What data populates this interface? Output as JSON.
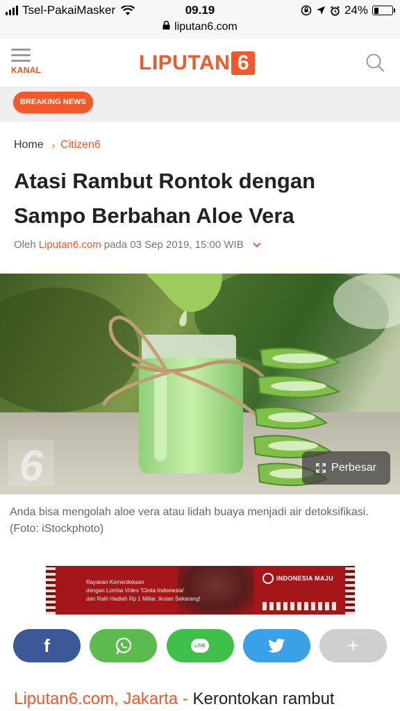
{
  "status_bar": {
    "carrier": "Tsel-PakaiMasker",
    "time": "09.19",
    "battery": "24%",
    "battery_level": 0.24
  },
  "browser": {
    "url": "liputan6.com"
  },
  "header": {
    "menu_label": "KANAL",
    "logo_text": "LIPUTAN",
    "logo_number": "6"
  },
  "breaking": {
    "label": "BREAKING NEWS"
  },
  "breadcrumb": {
    "home": "Home",
    "separator": "›",
    "category": "Citizen6"
  },
  "article": {
    "title": "Atasi Rambut Rontok dengan Sampo Berbahan Aloe Vera",
    "byline_prefix": "Oleh",
    "author": "Liputan6.com",
    "byline_date": "pada 03 Sep 2019, 15:00 WIB",
    "image_button": "Perbesar",
    "image_watermark": "6",
    "caption": "Anda bisa mengolah aloe vera atau lidah buaya menjadi air detoksifikasi. (Foto: iStockphoto)",
    "lead_dateline": "Liputan6.com, Jakarta - ",
    "lead_text": "Kerontokan rambut"
  },
  "ad": {
    "line1": "Rayakan Kemerdekaan",
    "line2_prefix": "dengan Lomba Video ",
    "line2_highlight": "'Cinta Indonesia'",
    "line3": "dan Raih Hadiah Rp 1 Miliar. Ikutan Sekarang!",
    "brand": "INDONESIA MAJU"
  },
  "share": {
    "facebook": "f",
    "whatsapp": "whatsapp-icon",
    "line": "LINE",
    "twitter": "twitter-icon",
    "more": "+"
  },
  "colors": {
    "brand_orange": "#f1592a",
    "facebook": "#3b5998",
    "whatsapp": "#5cbb4d",
    "line": "#3ec04a",
    "twitter": "#3aa1e8",
    "more": "#cfcfcf"
  }
}
